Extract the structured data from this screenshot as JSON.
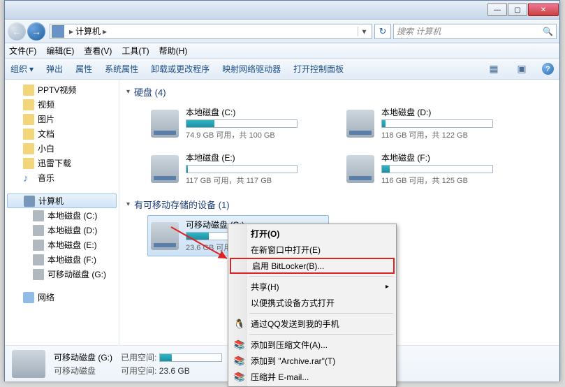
{
  "titlebar": {
    "min": "—",
    "max": "▢",
    "close": "✕"
  },
  "nav": {
    "back": "←",
    "fwd": "→",
    "crumb_root": "计算机",
    "sep": "▸",
    "drop": "▾",
    "refresh": "↻"
  },
  "search": {
    "placeholder": "搜索 计算机",
    "icon": "🔍"
  },
  "menu": {
    "file": "文件(F)",
    "edit": "编辑(E)",
    "view": "查看(V)",
    "tools": "工具(T)",
    "help": "帮助(H)"
  },
  "toolbar": {
    "org": "组织",
    "drop": "▾",
    "eject": "弹出",
    "props": "属性",
    "sysprops": "系统属性",
    "uninstall": "卸载或更改程序",
    "mapdrive": "映射网络驱动器",
    "ctrlpanel": "打开控制面板",
    "help": "?"
  },
  "sidebar": {
    "items": [
      {
        "label": "PPTV视频"
      },
      {
        "label": "视频"
      },
      {
        "label": "图片"
      },
      {
        "label": "文档"
      },
      {
        "label": "小白"
      },
      {
        "label": "迅雷下载"
      },
      {
        "label": "音乐"
      }
    ],
    "computer": "计算机",
    "drives": [
      {
        "label": "本地磁盘 (C:)"
      },
      {
        "label": "本地磁盘 (D:)"
      },
      {
        "label": "本地磁盘 (E:)"
      },
      {
        "label": "本地磁盘 (F:)"
      },
      {
        "label": "可移动磁盘 (G:)"
      }
    ],
    "network": "网络"
  },
  "main": {
    "group_hdd": "硬盘 (4)",
    "group_rem": "有可移动存储的设备 (1)",
    "drives": [
      {
        "name": "本地磁盘 (C:)",
        "stat": "74.9 GB 可用，共 100 GB",
        "pct": 25
      },
      {
        "name": "本地磁盘 (D:)",
        "stat": "118 GB 可用，共 122 GB",
        "pct": 3
      },
      {
        "name": "本地磁盘 (E:)",
        "stat": "117 GB 可用，共 117 GB",
        "pct": 1
      },
      {
        "name": "本地磁盘 (F:)",
        "stat": "116 GB 可用，共 125 GB",
        "pct": 7
      }
    ],
    "removable": {
      "name": "可移动磁盘 (G:)",
      "stat": "23.6 GB 可用，",
      "pct": 20
    }
  },
  "details": {
    "name": "可移动磁盘  (G:)",
    "type": "可移动磁盘",
    "used_label": "已用空间:",
    "free_label": "可用空间:",
    "free_val": "23.6 GB"
  },
  "ctx": {
    "open": "打开(O)",
    "newwin": "在新窗口中打开(E)",
    "bitlocker": "启用 BitLocker(B)...",
    "share": "共享(H)",
    "portable": "以便携式设备方式打开",
    "qq": "通过QQ发送到我的手机",
    "addarchive": "添加到压缩文件(A)...",
    "addto": "添加到 \"Archive.rar\"(T)",
    "email": "压缩并 E-mail...",
    "arrow": "▸"
  },
  "chart_data": [
    {
      "type": "bar",
      "title": "本地磁盘 (C:)",
      "categories": [
        "已用",
        "可用"
      ],
      "values": [
        25.1,
        74.9
      ],
      "ylabel": "GB",
      "ylim": [
        0,
        100
      ]
    },
    {
      "type": "bar",
      "title": "本地磁盘 (D:)",
      "categories": [
        "已用",
        "可用"
      ],
      "values": [
        4,
        118
      ],
      "ylabel": "GB",
      "ylim": [
        0,
        122
      ]
    },
    {
      "type": "bar",
      "title": "本地磁盘 (E:)",
      "categories": [
        "已用",
        "可用"
      ],
      "values": [
        0,
        117
      ],
      "ylabel": "GB",
      "ylim": [
        0,
        117
      ]
    },
    {
      "type": "bar",
      "title": "本地磁盘 (F:)",
      "categories": [
        "已用",
        "可用"
      ],
      "values": [
        9,
        116
      ],
      "ylabel": "GB",
      "ylim": [
        0,
        125
      ]
    },
    {
      "type": "bar",
      "title": "可移动磁盘 (G:)",
      "categories": [
        "已用",
        "可用"
      ],
      "values": [
        5.9,
        23.6
      ],
      "ylabel": "GB",
      "ylim": [
        0,
        29.5
      ]
    }
  ]
}
